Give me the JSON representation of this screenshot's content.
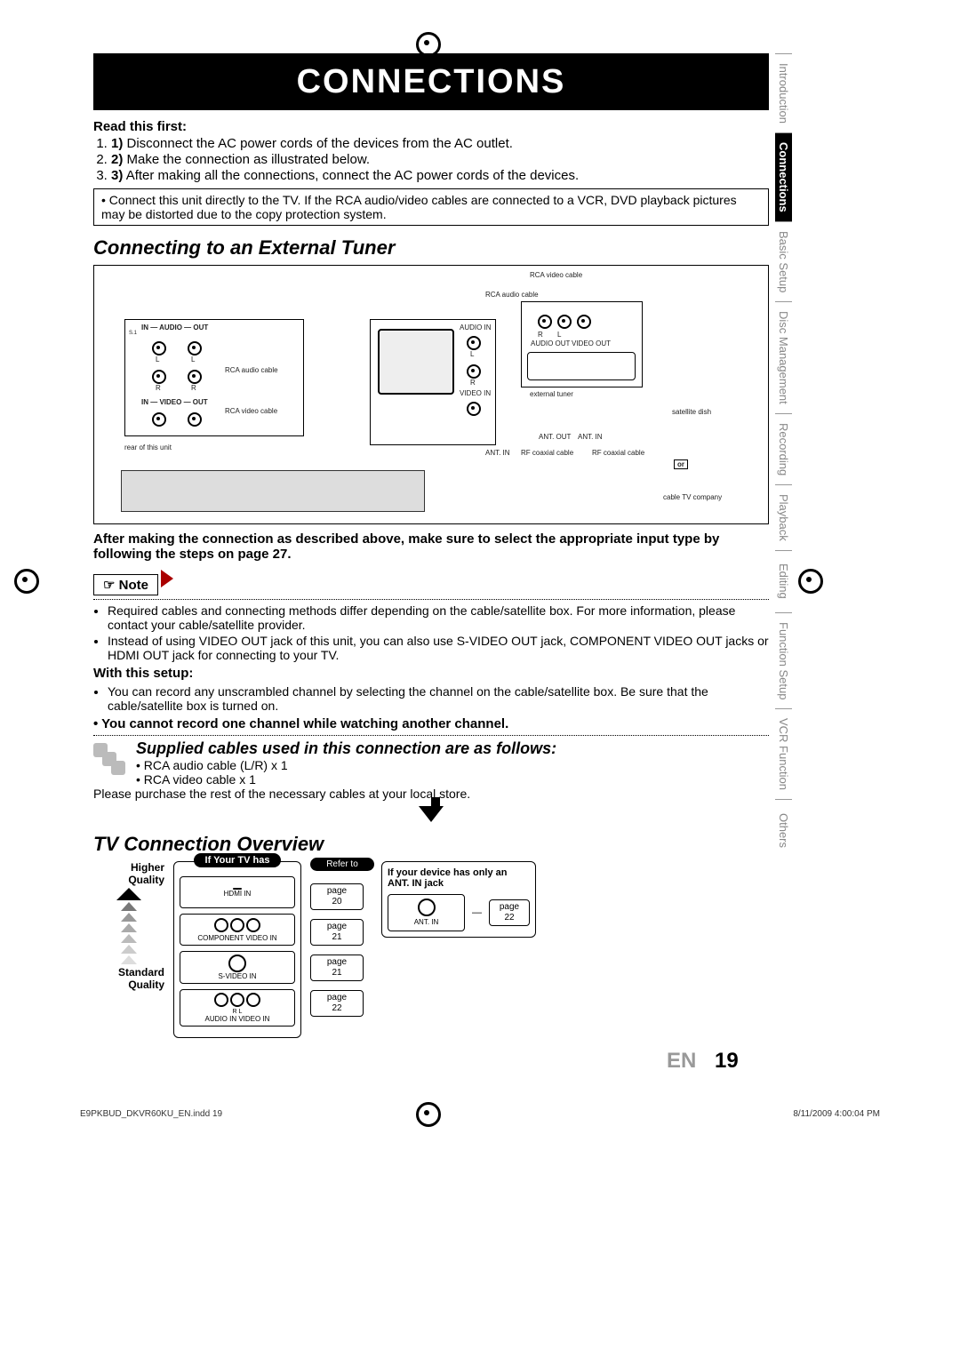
{
  "header": {
    "title": "CONNECTIONS"
  },
  "side_tabs": [
    {
      "label": "Introduction",
      "active": false
    },
    {
      "label": "Connections",
      "active": true
    },
    {
      "label": "Basic Setup",
      "active": false
    },
    {
      "label": "Disc Management",
      "active": false
    },
    {
      "label": "Recording",
      "active": false
    },
    {
      "label": "Playback",
      "active": false
    },
    {
      "label": "Editing",
      "active": false
    },
    {
      "label": "Function Setup",
      "active": false
    },
    {
      "label": "VCR Function",
      "active": false
    },
    {
      "label": "Others",
      "active": false
    }
  ],
  "read_first": {
    "heading": "Read this first:",
    "steps": [
      "Disconnect the AC power cords of the devices from the AC outlet.",
      "Make the connection as illustrated below.",
      "After making all the connections, connect the AC power cords of the devices."
    ],
    "info": "Connect this unit directly to the TV. If the RCA audio/video cables are connected to a VCR, DVD playback pictures may be distorted due to the copy protection system."
  },
  "section1": {
    "title": "Connecting to an External Tuner",
    "diagram_labels": {
      "rca_video_cable": "RCA video cable",
      "rca_audio_cable": "RCA audio cable",
      "in_audio_out": "IN — AUDIO — OUT",
      "l": "L",
      "r": "R",
      "in_video_out": "IN — VIDEO — OUT",
      "audio_in": "AUDIO IN",
      "video_in": "VIDEO IN",
      "audio_out": "AUDIO OUT",
      "video_out": "VIDEO OUT",
      "external_tuner": "external tuner",
      "satellite_dish": "satellite dish",
      "ant_out": "ANT. OUT",
      "ant_in": "ANT. IN",
      "rf_coax": "RF coaxial cable",
      "rear_of_unit": "rear of this unit",
      "or": "or",
      "cable_tv": "cable TV company",
      "s1": "S.1"
    },
    "after_note": "After making the connection as described above, make sure to select the appropriate input type by following the steps on page 27."
  },
  "note": {
    "label": "Note",
    "bullets": [
      "Required cables and connecting methods differ depending on the cable/satellite box. For more information, please contact your cable/satellite provider.",
      "Instead of using VIDEO OUT jack of this unit, you can also use S-VIDEO OUT jack, COMPONENT VIDEO OUT jacks or HDMI OUT jack for connecting to your TV."
    ],
    "with_setup": "With this setup:",
    "setup_bullets": [
      "You can record any unscrambled channel by selecting the channel on the cable/satellite box. Be sure that the cable/satellite box is turned on."
    ],
    "cannot": "• You cannot record one channel while watching another channel."
  },
  "supplied": {
    "title": "Supplied cables used in this connection are as follows:",
    "items": [
      "RCA audio cable (L/R) x 1",
      "RCA video cable x 1"
    ],
    "purchase": "Please purchase the rest of the necessary cables at your local store."
  },
  "section2": {
    "title": "TV Connection Overview",
    "higher": "Higher Quality",
    "standard": "Standard Quality",
    "if_tv_has": "If Your TV has",
    "refer_to": "Refer to",
    "options": [
      {
        "label": "HDMI IN",
        "page": "20"
      },
      {
        "label": "COMPONENT VIDEO IN",
        "page": "21"
      },
      {
        "label": "S-VIDEO IN",
        "page": "21"
      },
      {
        "label": "AUDIO IN  VIDEO IN",
        "page": "22",
        "sub": "R   L"
      }
    ],
    "ant": {
      "label": "If your device has only an ANT. IN jack",
      "jack": "ANT. IN",
      "page": "22"
    },
    "page_word": "page"
  },
  "footer": {
    "lang": "EN",
    "page": "19",
    "file": "E9PKBUD_DKVR60KU_EN.indd   19",
    "timestamp": "8/11/2009   4:00:04 PM"
  }
}
